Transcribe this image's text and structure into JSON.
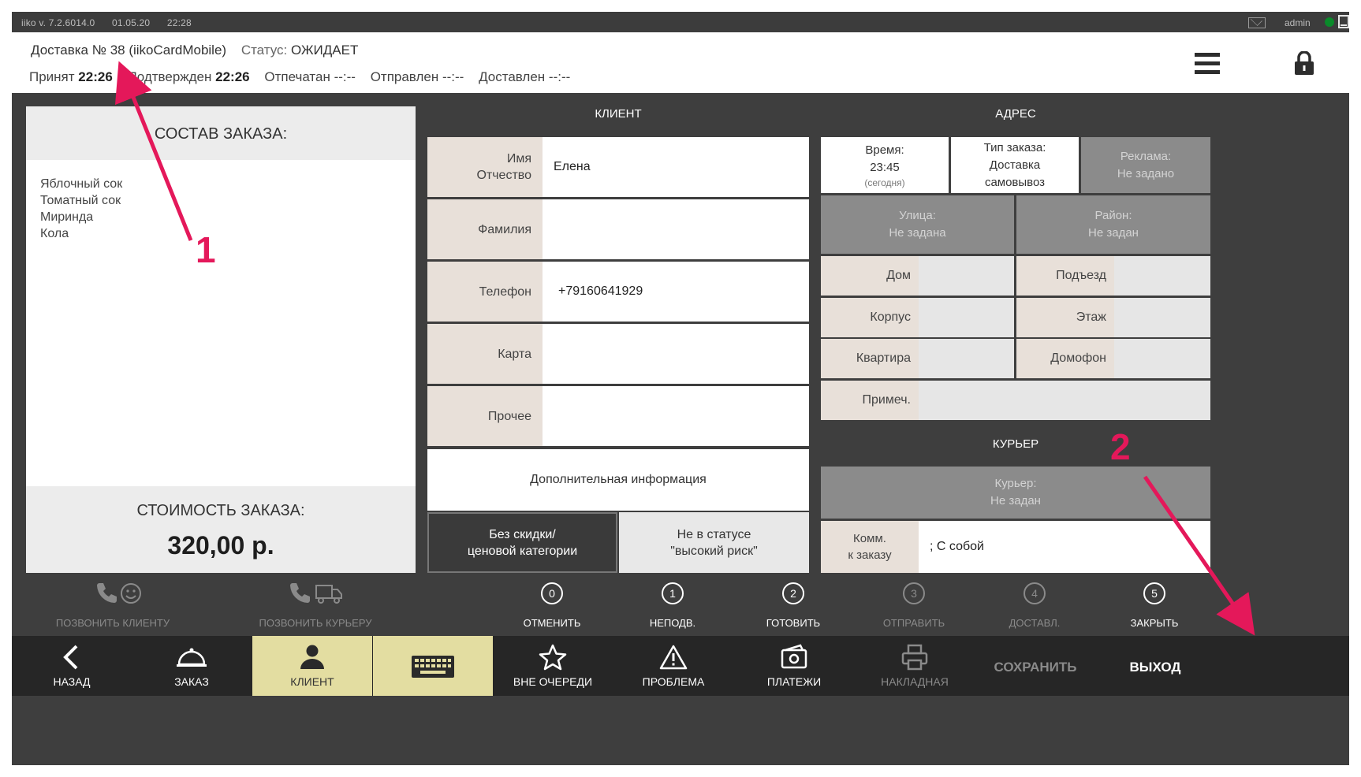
{
  "titlebar": {
    "app": "iiko v. 7.2.6014.0",
    "date": "01.05.20",
    "time": "22:28",
    "user": "admin",
    "icons": [
      "mail-icon",
      "status-dot-icon",
      "window-icon"
    ]
  },
  "header": {
    "order_label": "Доставка № 38 (iikoCardMobile)",
    "status_prefix": "Статус:",
    "status_value": "ОЖИДАЕТ",
    "accepted_label": "Принят",
    "accepted_time": "22:26",
    "confirmed_label": "Подтвержден",
    "confirmed_time": "22:26",
    "printed_label": "Отпечатан",
    "printed_time": "--:--",
    "sent_label": "Отправлен",
    "sent_time": "--:--",
    "delivered_label": "Доставлен",
    "delivered_time": "--:--"
  },
  "order": {
    "title": "СОСТАВ ЗАКАЗА:",
    "items": [
      "Яблочный сок",
      "Томатный сок",
      "Миринда",
      "Кола"
    ],
    "total_label": "СТОИМОСТЬ ЗАКАЗА:",
    "total_value": "320,00 р."
  },
  "client": {
    "title": "КЛИЕНТ",
    "rows": [
      {
        "label_1": "Имя",
        "label_2": "Отчество",
        "value": "Елена"
      },
      {
        "label_1": "Фамилия",
        "label_2": "",
        "value": ""
      },
      {
        "label_1": "Телефон",
        "label_2": "",
        "value": "+79160641929"
      },
      {
        "label_1": "Карта",
        "label_2": "",
        "value": ""
      },
      {
        "label_1": "Прочее",
        "label_2": "",
        "value": ""
      }
    ],
    "extra_info": "Дополнительная информация",
    "discount_1": "Без скидки/",
    "discount_2": "ценовой категории",
    "risk_1": "Не в статусе",
    "risk_2": "\"высокий риск\""
  },
  "address": {
    "title": "АДРЕС",
    "time_label": "Время:",
    "time_value": "23:45",
    "time_note": "(сегодня)",
    "order_type_label": "Тип заказа:",
    "order_type_value_1": "Доставка",
    "order_type_value_2": "самовывоз",
    "ad_label": "Реклама:",
    "ad_value": "Не задано",
    "street_label": "Улица:",
    "street_value": "Не задана",
    "district_label": "Район:",
    "district_value": "Не задан",
    "house": "Дом",
    "entrance": "Подъезд",
    "building": "Корпус",
    "floor": "Этаж",
    "apartment": "Квартира",
    "intercom": "Домофон",
    "note": "Примеч."
  },
  "courier": {
    "title": "КУРЬЕР",
    "label": "Курьер:",
    "value": "Не задан",
    "comment_label_1": "Комм.",
    "comment_label_2": "к заказу",
    "comment_value": "; С собой"
  },
  "actions": {
    "call_client": "ПОЗВОНИТЬ КЛИЕНТУ",
    "call_courier": "ПОЗВОНИТЬ КУРЬЕРУ",
    "statuses": [
      {
        "num": "0",
        "label": "ОТМЕНИТЬ",
        "enabled": true
      },
      {
        "num": "1",
        "label": "НЕПОДВ.",
        "enabled": true
      },
      {
        "num": "2",
        "label": "ГОТОВИТЬ",
        "enabled": true
      },
      {
        "num": "3",
        "label": "ОТПРАВИТЬ",
        "enabled": false
      },
      {
        "num": "4",
        "label": "ДОСТАВЛ.",
        "enabled": false
      },
      {
        "num": "5",
        "label": "ЗАКРЫТЬ",
        "enabled": true
      }
    ]
  },
  "nav": {
    "back": "НАЗАД",
    "order": "ЗАКАЗ",
    "client": "КЛИЕНТ",
    "out_of_queue": "ВНЕ ОЧЕРЕДИ",
    "problem": "ПРОБЛЕМА",
    "payments": "ПЛАТЕЖИ",
    "invoice": "НАКЛАДНАЯ",
    "save": "СОХРАНИТЬ",
    "exit": "ВЫХОД"
  },
  "annotations": {
    "marker_1": "1",
    "marker_2": "2",
    "color": "#e4185a"
  },
  "colors": {
    "accent_active": "#e3dda1",
    "label_bg": "#e8e0d9",
    "dark_bg": "#3e3e3e"
  }
}
